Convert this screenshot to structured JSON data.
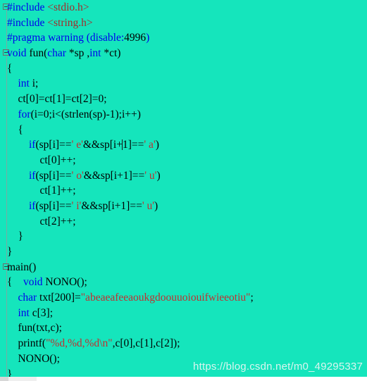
{
  "editor": {
    "background_color": "#15e5bc",
    "keyword_color": "#0000ee",
    "string_color": "#c03030",
    "include_color": "#a52a2a",
    "text_color": "#000000",
    "language": "C"
  },
  "watermark": {
    "text": "https://blog.csdn.net/m0_49295337"
  },
  "code": {
    "lines": [
      {
        "n": 1,
        "fold": "open",
        "tokens": [
          {
            "t": "#include ",
            "c": "pre"
          },
          {
            "t": "<stdio.h>",
            "c": "inc"
          }
        ]
      },
      {
        "n": 2,
        "fold": "none",
        "tokens": [
          {
            "t": "#include ",
            "c": "pre"
          },
          {
            "t": "<string.h>",
            "c": "inc"
          }
        ]
      },
      {
        "n": 3,
        "fold": "none",
        "tokens": [
          {
            "t": "#pragma warning (disable:",
            "c": "pre"
          },
          {
            "t": "4996",
            "c": "num"
          },
          {
            "t": ")",
            "c": "pre"
          }
        ]
      },
      {
        "n": 4,
        "fold": "open",
        "tokens": [
          {
            "t": "void",
            "c": "kw"
          },
          {
            "t": " fun(",
            "c": "plain"
          },
          {
            "t": "char",
            "c": "kw"
          },
          {
            "t": " *sp ,",
            "c": "plain"
          },
          {
            "t": "int",
            "c": "kw"
          },
          {
            "t": " *ct)",
            "c": "plain"
          }
        ]
      },
      {
        "n": 5,
        "fold": "none",
        "tokens": [
          {
            "t": "{",
            "c": "plain"
          }
        ]
      },
      {
        "n": 6,
        "fold": "none",
        "tokens": [
          {
            "t": "    ",
            "c": "plain"
          },
          {
            "t": "int",
            "c": "kw"
          },
          {
            "t": " i;",
            "c": "plain"
          }
        ]
      },
      {
        "n": 7,
        "fold": "none",
        "tokens": [
          {
            "t": "    ct[0]=ct[1]=ct[2]=0;",
            "c": "plain"
          }
        ]
      },
      {
        "n": 8,
        "fold": "none",
        "tokens": [
          {
            "t": "    ",
            "c": "plain"
          },
          {
            "t": "for",
            "c": "kw"
          },
          {
            "t": "(i=0;i<(strlen(sp)-1);i++)",
            "c": "plain"
          }
        ]
      },
      {
        "n": 9,
        "fold": "none",
        "tokens": [
          {
            "t": "    {",
            "c": "plain"
          }
        ]
      },
      {
        "n": 10,
        "fold": "none",
        "tokens": [
          {
            "t": "        ",
            "c": "plain"
          },
          {
            "t": "if",
            "c": "kw"
          },
          {
            "t": "(sp[i]==",
            "c": "plain"
          },
          {
            "t": "' e'",
            "c": "chr"
          },
          {
            "t": "&&sp[i+",
            "c": "plain"
          },
          {
            "t": "|CARET|",
            "c": "caret"
          },
          {
            "t": "1]==",
            "c": "plain"
          },
          {
            "t": "' a'",
            "c": "chr"
          },
          {
            "t": ")",
            "c": "plain"
          }
        ]
      },
      {
        "n": 11,
        "fold": "none",
        "tokens": [
          {
            "t": "            ct[0]++;",
            "c": "plain"
          }
        ]
      },
      {
        "n": 12,
        "fold": "none",
        "tokens": [
          {
            "t": "        ",
            "c": "plain"
          },
          {
            "t": "if",
            "c": "kw"
          },
          {
            "t": "(sp[i]==",
            "c": "plain"
          },
          {
            "t": "' o'",
            "c": "chr"
          },
          {
            "t": "&&sp[i+1]==",
            "c": "plain"
          },
          {
            "t": "' u'",
            "c": "chr"
          },
          {
            "t": ")",
            "c": "plain"
          }
        ]
      },
      {
        "n": 13,
        "fold": "none",
        "tokens": [
          {
            "t": "            ct[1]++;",
            "c": "plain"
          }
        ]
      },
      {
        "n": 14,
        "fold": "none",
        "tokens": [
          {
            "t": "        ",
            "c": "plain"
          },
          {
            "t": "if",
            "c": "kw"
          },
          {
            "t": "(sp[i]==",
            "c": "plain"
          },
          {
            "t": "' i'",
            "c": "chr"
          },
          {
            "t": "&&sp[i+1]==",
            "c": "plain"
          },
          {
            "t": "' u'",
            "c": "chr"
          },
          {
            "t": ")",
            "c": "plain"
          }
        ]
      },
      {
        "n": 15,
        "fold": "none",
        "tokens": [
          {
            "t": "            ct[2]++;",
            "c": "plain"
          }
        ]
      },
      {
        "n": 16,
        "fold": "none",
        "tokens": [
          {
            "t": "    }",
            "c": "plain"
          }
        ]
      },
      {
        "n": 17,
        "fold": "none",
        "tokens": [
          {
            "t": "}",
            "c": "plain"
          }
        ]
      },
      {
        "n": 18,
        "fold": "open",
        "tokens": [
          {
            "t": "main()",
            "c": "plain"
          }
        ]
      },
      {
        "n": 19,
        "fold": "none",
        "tokens": [
          {
            "t": "{    ",
            "c": "plain"
          },
          {
            "t": "void",
            "c": "kw"
          },
          {
            "t": " NONO();",
            "c": "plain"
          }
        ]
      },
      {
        "n": 20,
        "fold": "none",
        "tokens": [
          {
            "t": "    ",
            "c": "plain"
          },
          {
            "t": "char",
            "c": "kw"
          },
          {
            "t": " txt[200]=",
            "c": "plain"
          },
          {
            "t": "\"abeaeafeeaoukgdoouuoiouifwieeotiu\"",
            "c": "str"
          },
          {
            "t": ";",
            "c": "plain"
          }
        ]
      },
      {
        "n": 21,
        "fold": "none",
        "tokens": [
          {
            "t": "    ",
            "c": "plain"
          },
          {
            "t": "int",
            "c": "kw"
          },
          {
            "t": " c[3];",
            "c": "plain"
          }
        ]
      },
      {
        "n": 22,
        "fold": "none",
        "tokens": [
          {
            "t": "    fun(txt,c);",
            "c": "plain"
          }
        ]
      },
      {
        "n": 23,
        "fold": "none",
        "tokens": [
          {
            "t": "    printf(",
            "c": "plain"
          },
          {
            "t": "\"%d,%d,%d\\n\"",
            "c": "str"
          },
          {
            "t": ",c[0],c[1],c[2]);",
            "c": "plain"
          }
        ]
      },
      {
        "n": 24,
        "fold": "none",
        "tokens": [
          {
            "t": "    NONO();",
            "c": "plain"
          }
        ]
      },
      {
        "n": 25,
        "fold": "none",
        "tokens": [
          {
            "t": "}",
            "c": "plain"
          }
        ]
      }
    ]
  }
}
